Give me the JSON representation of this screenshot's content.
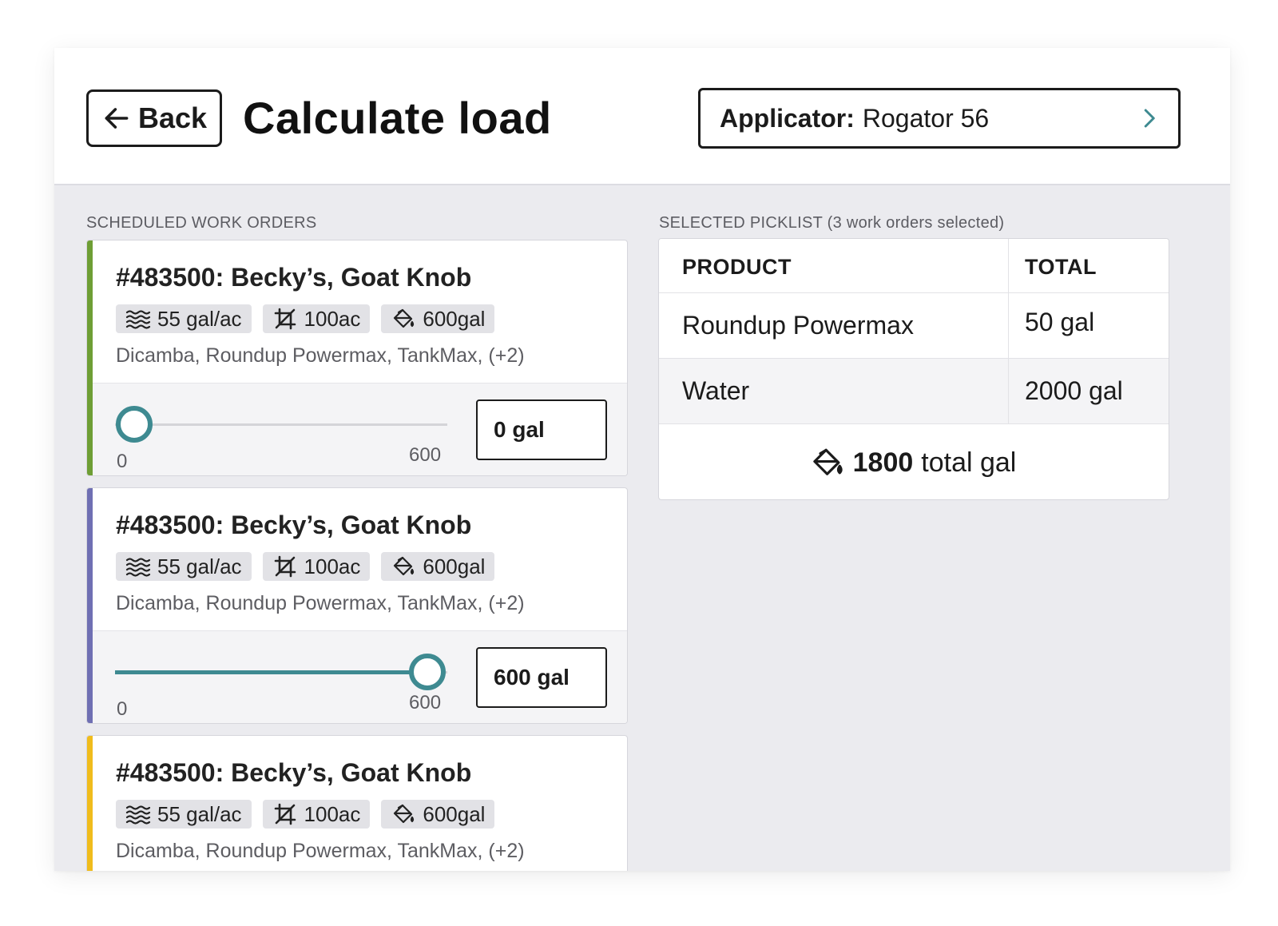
{
  "header": {
    "back_label": "Back",
    "title": "Calculate load",
    "applicator_label": "Applicator:",
    "applicator_value": "Rogator 56"
  },
  "work_orders": {
    "section_label": "SCHEDULED WORK ORDERS",
    "items": [
      {
        "title": "#483500: Becky’s, Goat Knob",
        "accent_color": "#6e9e35",
        "rate": "55 gal/ac",
        "area": "100ac",
        "volume": "600gal",
        "products": "Dicamba, Roundup Powermax, TankMax, (+2)",
        "slider_min": "0",
        "slider_max": "600",
        "slider_value": 0,
        "amount": "0 gal"
      },
      {
        "title": "#483500: Becky’s, Goat Knob",
        "accent_color": "#6f6fb3",
        "rate": "55 gal/ac",
        "area": "100ac",
        "volume": "600gal",
        "products": "Dicamba, Roundup Powermax, TankMax, (+2)",
        "slider_min": "0",
        "slider_max": "600",
        "slider_value": 600,
        "amount": "600 gal"
      },
      {
        "title": "#483500: Becky’s, Goat Knob",
        "accent_color": "#f0bc1c",
        "rate": "55 gal/ac",
        "area": "100ac",
        "volume": "600gal",
        "products": "Dicamba, Roundup Powermax, TankMax, (+2)"
      }
    ]
  },
  "picklist": {
    "section_label": "SELECTED PICKLIST (3 work orders selected)",
    "col_product": "PRODUCT",
    "col_total": "TOTAL",
    "rows": [
      {
        "product": "Roundup Powermax",
        "total": "50 gal"
      },
      {
        "product": "Water",
        "total": "2000 gal"
      }
    ],
    "total_number": "1800",
    "total_unit": "total gal"
  },
  "colors": {
    "accent_teal": "#3e8a91"
  },
  "icons": {
    "back": "arrow-left-icon",
    "applicator": "chevron-right-icon",
    "rate": "waves-icon",
    "area": "crop-icon",
    "volume": "paint-bucket-icon"
  }
}
